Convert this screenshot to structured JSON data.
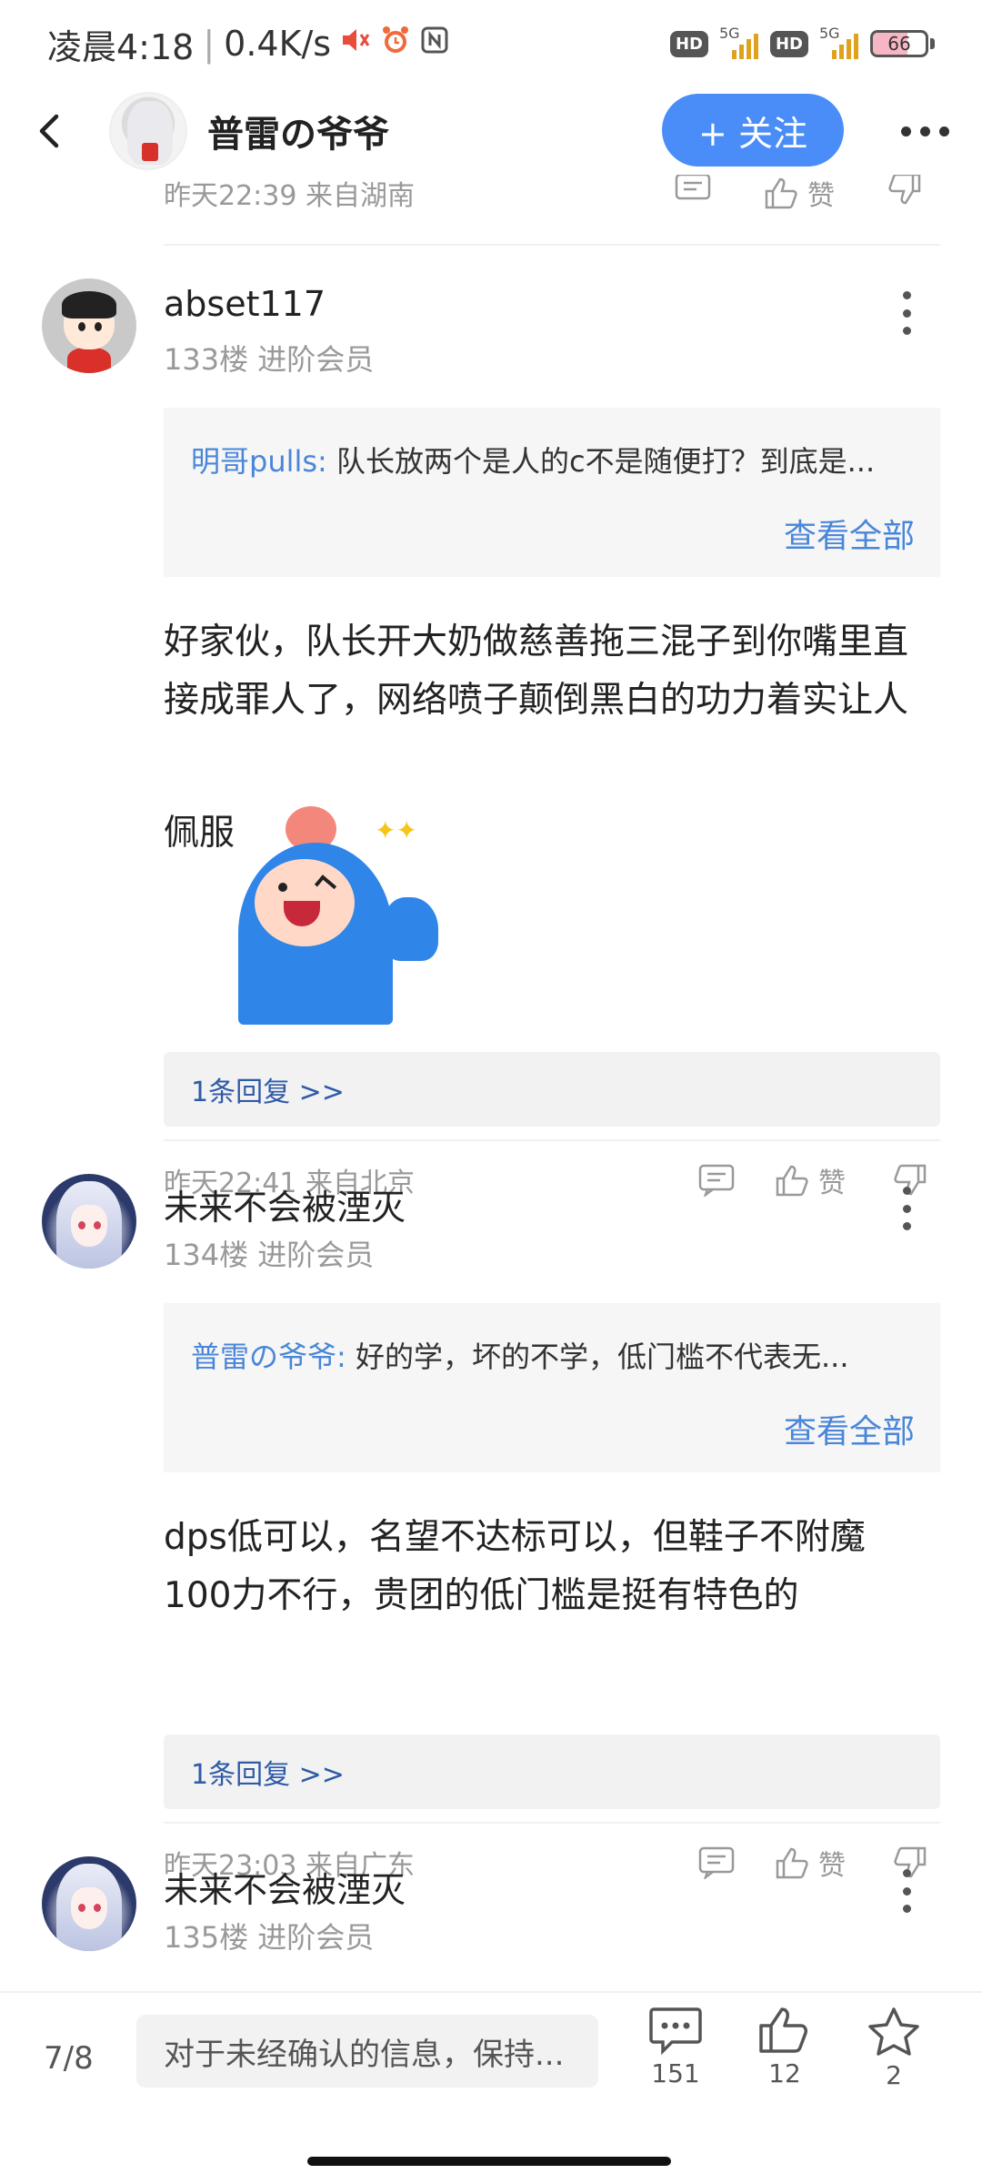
{
  "status_bar": {
    "time": "凌晨4:18",
    "speed": "0.4K/s",
    "hd1": "HD",
    "hd2": "HD",
    "net1": "5G",
    "net2": "5G",
    "battery": "66",
    "battery_level": 0.66,
    "icons": [
      "mute-icon",
      "alarm-icon",
      "nfc-icon",
      "signal-icon",
      "battery-icon"
    ]
  },
  "header": {
    "title": "普雷の爷爷",
    "follow_label": "+ 关注"
  },
  "partial_post": {
    "meta": "昨天22:39 来自湖南",
    "like_label": "赞"
  },
  "posts": [
    {
      "user": "abset117",
      "meta": "133楼 进阶会员",
      "quote_name": "明哥pulls:",
      "quote_text": " 队长放两个是人的c不是随便打？到底是...",
      "quote_more": "查看全部",
      "body_line1": "好家伙，队长开大奶做慈善拖三混子到你嘴里直",
      "body_line2": "接成罪人了，网络喷子颠倒黑白的功力着实让人",
      "body_line3": "佩服",
      "replies": "1条回复 >>",
      "time_loc": "昨天22:41 来自北京",
      "like_label": "赞"
    },
    {
      "user": "未来不会被湮灭",
      "meta": "134楼 进阶会员",
      "quote_name": "普雷の爷爷:",
      "quote_text": " 好的学，坏的不学，低门槛不代表无...",
      "quote_more": "查看全部",
      "body_line1": "dps低可以，名望不达标可以，但鞋子不附魔",
      "body_line2": "100力不行，贵团的低门槛是挺有特色的",
      "replies": "1条回复 >>",
      "time_loc": "昨天23:03 来自广东",
      "like_label": "赞"
    },
    {
      "user": "未来不会被湮灭",
      "meta": "135楼 进阶会员"
    }
  ],
  "bottom_bar": {
    "page": "7/8",
    "input_placeholder": "对于未经确认的信息，保持...",
    "comments": "151",
    "likes": "12",
    "stars": "2"
  },
  "colors": {
    "accent": "#4a8df8",
    "link": "#4a86d8",
    "reply_link": "#2f5aa8",
    "muted": "#999999"
  }
}
